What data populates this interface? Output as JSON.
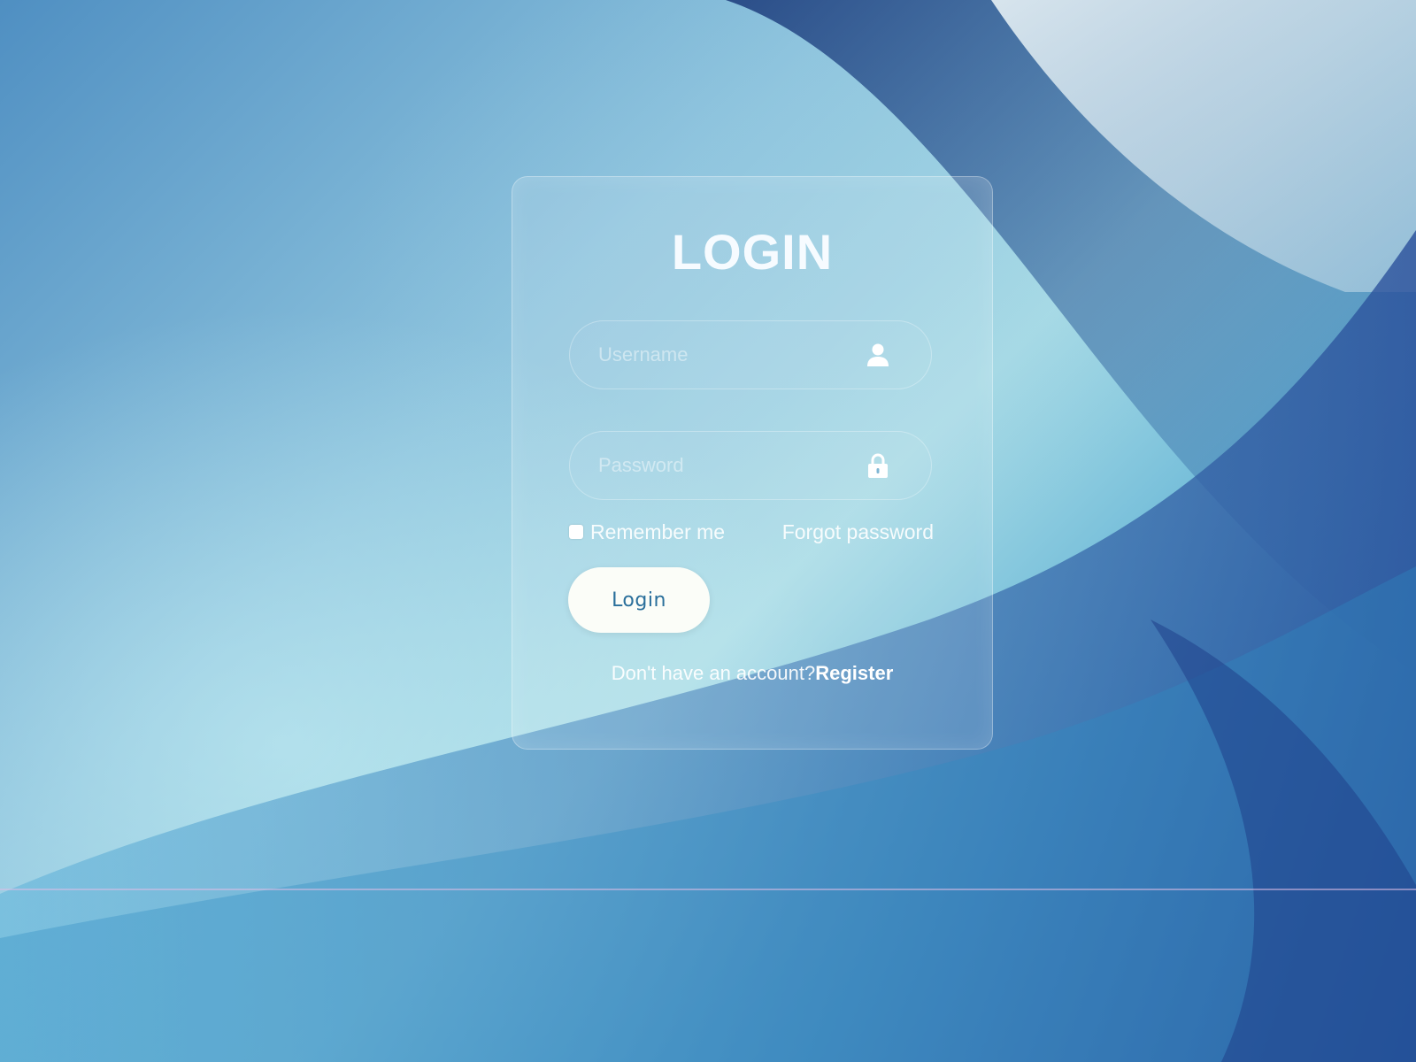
{
  "login_form": {
    "title": "LOGIN",
    "username": {
      "placeholder": "Username",
      "value": "",
      "icon": "user-icon"
    },
    "password": {
      "placeholder": "Password",
      "value": "",
      "icon": "lock-icon"
    },
    "remember_me": {
      "label": "Remember me",
      "checked": false
    },
    "forgot_password_label": "Forgot password",
    "login_button_label": "Login",
    "register_prompt": "Don't have an account?",
    "register_link_label": "Register"
  },
  "colors": {
    "background_primary": "#4f8fc2",
    "background_light": "#a9dce6",
    "background_dark": "#2f5fa5",
    "button_background": "#fbfdf8",
    "button_text": "#2a6f9b",
    "text_light": "#ffffff"
  }
}
